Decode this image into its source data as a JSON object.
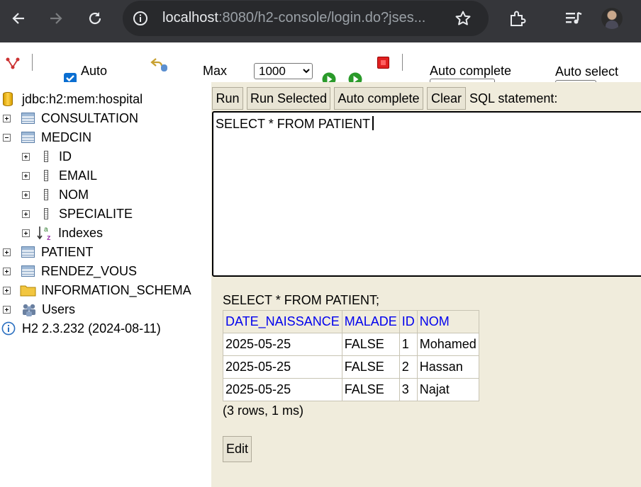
{
  "browser": {
    "url_host": "localhost",
    "url_path": ":8080/h2-console/login.do?jses...",
    "icons": [
      "back-arrow-icon",
      "forward-arrow-icon",
      "reload-icon",
      "site-info-icon",
      "bookmark-star-icon",
      "extensions-icon",
      "media-control-icon",
      "profile-avatar"
    ]
  },
  "toolbar": {
    "auto_label": "Auto",
    "max_label": "Max",
    "max_value": "1000",
    "max_options": [
      "1000"
    ],
    "auto_complete_label": "Auto complete",
    "auto_select_label": "Auto select"
  },
  "tree": {
    "connection": "jdbc:h2:mem:hospital",
    "items": [
      {
        "label": "CONSULTATION",
        "type": "table",
        "expanded": false
      },
      {
        "label": "MEDCIN",
        "type": "table",
        "expanded": true
      },
      {
        "label": "ID",
        "type": "column"
      },
      {
        "label": "EMAIL",
        "type": "column"
      },
      {
        "label": "NOM",
        "type": "column"
      },
      {
        "label": "SPECIALITE",
        "type": "column"
      },
      {
        "label": "Indexes",
        "type": "indexes"
      },
      {
        "label": "PATIENT",
        "type": "table",
        "expanded": false
      },
      {
        "label": "RENDEZ_VOUS",
        "type": "table",
        "expanded": false
      },
      {
        "label": "INFORMATION_SCHEMA",
        "type": "folder"
      },
      {
        "label": "Users",
        "type": "users"
      }
    ],
    "version": "H2 2.3.232 (2024-08-11)"
  },
  "sql_panel": {
    "buttons": [
      "Run",
      "Run Selected",
      "Auto complete",
      "Clear"
    ],
    "statement_label": "SQL statement:",
    "statement": "SELECT * FROM PATIENT"
  },
  "result": {
    "query": "SELECT * FROM PATIENT;",
    "columns": [
      "DATE_NAISSANCE",
      "MALADE",
      "ID",
      "NOM"
    ],
    "rows": [
      [
        "2025-05-25",
        "FALSE",
        "1",
        "Mohamed"
      ],
      [
        "2025-05-25",
        "FALSE",
        "2",
        "Hassan"
      ],
      [
        "2025-05-25",
        "FALSE",
        "3",
        "Najat"
      ]
    ],
    "summary": "(3 rows, 1 ms)",
    "edit_label": "Edit"
  }
}
